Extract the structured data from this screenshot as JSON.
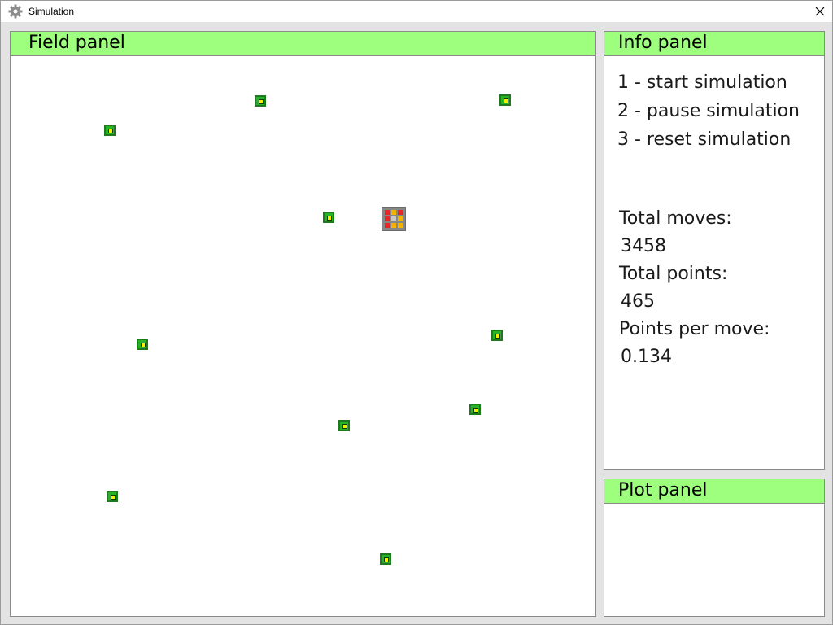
{
  "window": {
    "title": "Simulation",
    "icon": "gear-icon",
    "close_icon": "close-icon"
  },
  "field_panel": {
    "title": "Field panel",
    "food_items_count_note": "",
    "agent_cells": [
      "red",
      "yellow",
      "red",
      "red",
      "silver",
      "yellow",
      "red",
      "yellow",
      "yellow"
    ]
  },
  "info_panel": {
    "title": "Info panel",
    "instructions": [
      "1 - start simulation",
      "2 - pause simulation",
      "3 - reset simulation"
    ],
    "total_moves_label": "Total moves:",
    "total_moves_value": "3458",
    "total_points_label": "Total points:",
    "total_points_value": "465",
    "points_per_move_label": "Points per move:",
    "points_per_move_value": "0.134"
  },
  "plot_panel": {
    "title": "Plot panel"
  },
  "colors": {
    "panel_header": "#9eff7e",
    "food": "#27b227",
    "food_center": "#f2f200",
    "agent_red": "#e02a2a",
    "agent_yellow": "#f2b400",
    "agent_silver": "#c8c8c8"
  }
}
